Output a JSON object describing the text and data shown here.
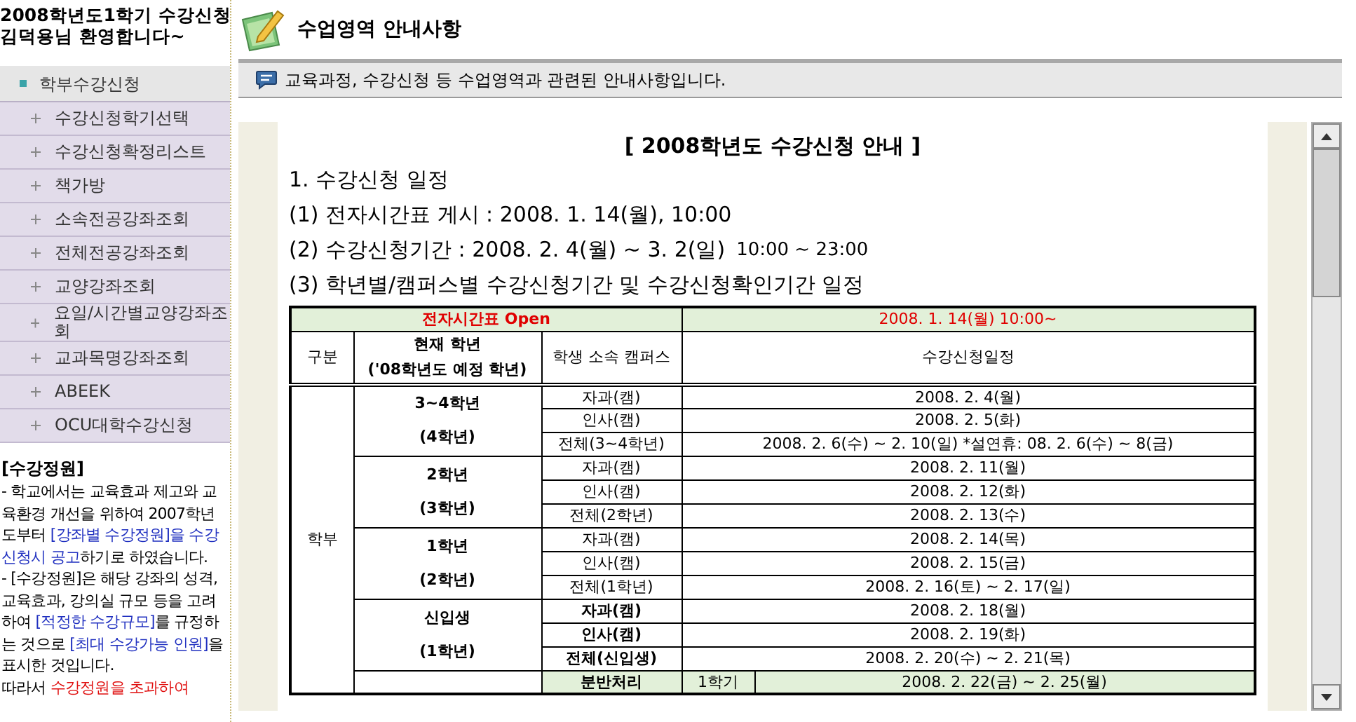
{
  "sidebar": {
    "greeting": [
      "2008학년도1학기 수강신청",
      "김덕용님 환영합니다~"
    ],
    "menu": {
      "header": "학부수강신청",
      "items": [
        {
          "label": "수강신청학기선택"
        },
        {
          "label": "수강신청확정리스트"
        },
        {
          "label": "책가방"
        },
        {
          "label": "소속전공강좌조회"
        },
        {
          "label": "전체전공강좌조회"
        },
        {
          "label": "교양강좌조회"
        },
        {
          "label": "요일/시간별교양강좌조회"
        },
        {
          "label": "교과목명강좌조회"
        },
        {
          "label": "ABEEK"
        },
        {
          "label": "OCU대학수강신청"
        }
      ]
    },
    "notice": {
      "title": "[수강정원]",
      "paragraphs": [
        [
          {
            "kind": "plain",
            "text": "- 학교에서는 교육효과 제고와 교육환경 개선을 위하여 2007학년도부터 "
          },
          {
            "kind": "link",
            "text": "[강좌별 수강정원]을 수강신청시 공고"
          },
          {
            "kind": "plain",
            "text": "하기로 하였습니다."
          }
        ],
        [
          {
            "kind": "plain",
            "text": "- [수강정원]은 해당 강좌의 성격, 교육효과, 강의실 규모 등을 고려하여 "
          },
          {
            "kind": "link",
            "text": "[적정한 수강규모]"
          },
          {
            "kind": "plain",
            "text": "를 규정하는 것으로 "
          },
          {
            "kind": "link",
            "text": "[최대 수강가능 인원]"
          },
          {
            "kind": "plain",
            "text": "을 표시한 것입니다."
          }
        ],
        [
          {
            "kind": "plain",
            "text": "따라서 "
          },
          {
            "kind": "warning",
            "text": "수강정원을 초과하여"
          }
        ]
      ]
    }
  },
  "page_header": {
    "title": "수업영역 안내사항"
  },
  "info_bar": {
    "text": "교육과정, 수강신청 등 수업영역과 관련된 안내사항입니다."
  },
  "document": {
    "title": "[ 2008학년도 수강신청 안내 ]",
    "lines": [
      {
        "text": "1. 수강신청 일정"
      },
      {
        "text": "(1) 전자시간표 게시 : 2008. 1. 14(월), 10:00"
      },
      {
        "text": "(2) 수강신청기간 : 2008. 2. 4(월) ~ 3. 2(일)",
        "note": "10:00 ~ 23:00"
      },
      {
        "text": "(3) 학년별/캠퍼스별 수강신청기간 및 수강신청확인기간 일정"
      }
    ],
    "schedule_table": {
      "open_row": {
        "label": "전자시간표 Open",
        "date": "2008. 1. 14(월) 10:00~"
      },
      "header": {
        "division": "구분",
        "grade": "현재 학년",
        "grade_note": "('08학년도 예정 학년)",
        "campus": "학생 소속 캠퍼스",
        "schedule": "수강신청일정"
      },
      "division": "학부",
      "groups": [
        {
          "grade": "3~4학년",
          "grade_note": "(4학년)",
          "bold": false,
          "rows": [
            {
              "campus": "자과(캠)",
              "date": "2008. 2. 4(월)"
            },
            {
              "campus": "인사(캠)",
              "date": "2008. 2. 5(화)"
            },
            {
              "campus": "전체(3~4학년)",
              "date": "2008. 2. 6(수) ~ 2. 10(일) *설연휴: 08. 2. 6(수) ~ 8(금)"
            }
          ]
        },
        {
          "grade": "2학년",
          "grade_note": "(3학년)",
          "bold": false,
          "rows": [
            {
              "campus": "자과(캠)",
              "date": "2008. 2. 11(월)"
            },
            {
              "campus": "인사(캠)",
              "date": "2008. 2. 12(화)"
            },
            {
              "campus": "전체(2학년)",
              "date": "2008. 2. 13(수)"
            }
          ]
        },
        {
          "grade": "1학년",
          "grade_note": "(2학년)",
          "bold": false,
          "rows": [
            {
              "campus": "자과(캠)",
              "date": "2008. 2. 14(목)"
            },
            {
              "campus": "인사(캠)",
              "date": "2008. 2. 15(금)"
            },
            {
              "campus": "전체(1학년)",
              "date": "2008. 2. 16(토) ~ 2. 17(일)"
            }
          ]
        },
        {
          "grade": "신입생",
          "grade_note": "(1학년)",
          "bold": true,
          "rows": [
            {
              "campus": "자과(캠)",
              "date": "2008. 2. 18(월)"
            },
            {
              "campus": "인사(캠)",
              "date": "2008. 2. 19(화)"
            },
            {
              "campus": "전체(신입생)",
              "date": "2008. 2. 20(수) ~ 2. 21(목)"
            }
          ]
        }
      ],
      "split_row": {
        "label": "분반처리",
        "term": "1학기",
        "date": "2008. 2. 22(금) ~ 2. 25(월)"
      }
    }
  }
}
